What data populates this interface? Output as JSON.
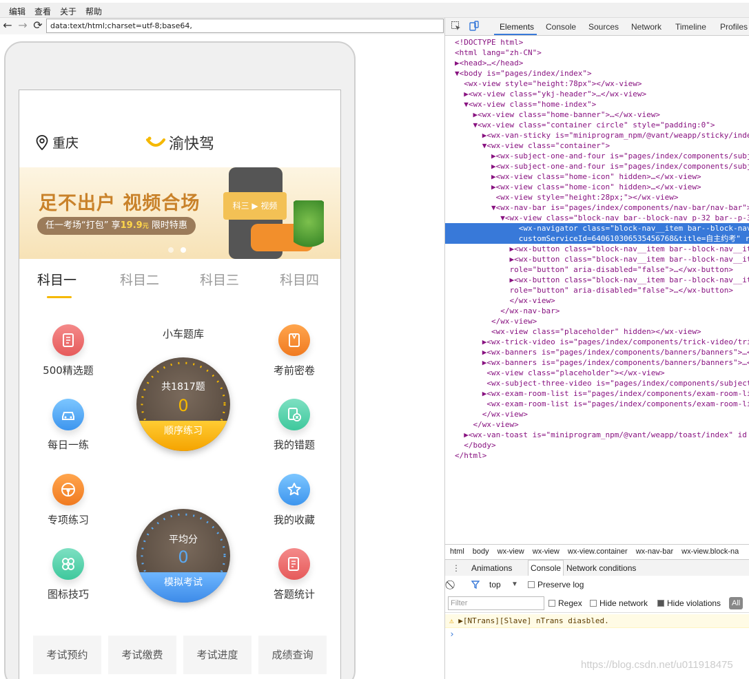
{
  "menu": [
    "编辑",
    "查看",
    "关于",
    "帮助"
  ],
  "browser": {
    "url": "data:text/html;charset=utf-8;base64,"
  },
  "miniapp": {
    "city": "重庆",
    "logo_text": "渝快驾",
    "banner": {
      "title": "足不出户 视频合场",
      "tag_prefix": "任一考场“打包”",
      "tag_price_label": "享",
      "tag_price": "19.9",
      "tag_price_unit": "元",
      "tag_suffix": "限时特惠",
      "screen_text": "科三 ▶ 视频"
    },
    "tabs": [
      "科目一",
      "科目二",
      "科目三",
      "科目四"
    ],
    "center_title": "小车题库",
    "left_items": [
      "500精选题",
      "每日一练",
      "专项练习",
      "图标技巧"
    ],
    "right_items": [
      "考前密卷",
      "我的错题",
      "我的收藏",
      "答题统计"
    ],
    "dial1": {
      "label": "共1817题",
      "value": "0",
      "button": "顺序练习"
    },
    "dial2": {
      "label": "平均分",
      "value": "0",
      "button": "模拟考试"
    },
    "bottom_buttons": [
      "考试预约",
      "考试缴费",
      "考试进度",
      "成绩查询"
    ],
    "colors": {
      "accent": "#f5b800",
      "blue": "#3d8be8"
    }
  },
  "devtools": {
    "tabs": [
      "Elements",
      "Console",
      "Sources",
      "Network",
      "Timeline",
      "Profiles"
    ],
    "tree": [
      "<!DOCTYPE html>",
      "<html lang=\"zh-CN\">",
      "▶<head>…</head>",
      "▼<body is=\"pages/index/index\">",
      "  <wx-view style=\"height:78px\"></wx-view>",
      "  ▶<wx-view class=\"ykj-header\">…</wx-view>",
      "  ▼<wx-view class=\"home-index\">",
      "    ▶<wx-view class=\"home-banner\">…</wx-view>",
      "    ▼<wx-view class=\"container circle\" style=\"padding:0\">",
      "      ▶<wx-van-sticky is=\"miniprogram_npm/@vant/weapp/sticky/inde",
      "      ▼<wx-view class=\"container\">",
      "        ▶<wx-subject-one-and-four is=\"pages/index/components/subj",
      "        ▶<wx-subject-one-and-four is=\"pages/index/components/subj",
      "        ▶<wx-view class=\"home-icon\" hidden>…</wx-view>",
      "        ▶<wx-view class=\"home-icon\" hidden>…</wx-view>",
      "         <wx-view style=\"height:28px;\"></wx-view>",
      "        ▼<wx-nav-bar is=\"pages/index/components/nav-bar/nav-bar\">",
      "          ▼<wx-view class=\"block-nav bar--block-nav p-32 bar--p-3",
      "              <wx-navigator class=\"block-nav__item bar--block-nav_",
      "              customServiceId=640610306535456768&title=自主约考\" ro",
      "            ▶<wx-button class=\"block-nav__item bar--block-nav__it",
      "            ▶<wx-button class=\"block-nav__item bar--block-nav__it",
      "            role=\"button\" aria-disabled=\"false\">…</wx-button>",
      "            ▶<wx-button class=\"block-nav__item bar--block-nav__it",
      "            role=\"button\" aria-disabled=\"false\">…</wx-button>",
      "            </wx-view>",
      "          </wx-nav-bar>",
      "        </wx-view>",
      "        <wx-view class=\"placeholder\" hidden></wx-view>",
      "      ▶<wx-trick-video is=\"pages/index/components/trick-video/tri",
      "      ▶<wx-banners is=\"pages/index/components/banners/banners\">…<",
      "      ▶<wx-banners is=\"pages/index/components/banners/banners\">…<",
      "       <wx-view class=\"placeholder\"></wx-view>",
      "       <wx-subject-three-video is=\"pages/index/components/subject",
      "      ▶<wx-exam-room-list is=\"pages/index/components/exam-room-li",
      "       <wx-exam-room-list is=\"pages/index/components/exam-room-li",
      "      </wx-view>",
      "    </wx-view>",
      "  ▶<wx-van-toast is=\"miniprogram_npm/@vant/weapp/toast/index\" id",
      "  </body>",
      "</html>"
    ],
    "selected_line": 18,
    "crumbs": [
      "html",
      "body",
      "wx-view",
      "wx-view",
      "wx-view.container",
      "wx-nav-bar",
      "wx-view.block-na"
    ],
    "drawer_tabs": [
      "Animations",
      "Console",
      "Network conditions"
    ],
    "console_context": "top",
    "preserve_log": "Preserve log",
    "filter_placeholder": "Filter",
    "regex": "Regex",
    "hide_network": "Hide network",
    "hide_violations": "Hide violations",
    "all_label": "All",
    "warning": "▶[NTrans][Slave] nTrans diasbled.",
    "prompt": "›"
  },
  "watermark": "https://blog.csdn.net/u011918475"
}
